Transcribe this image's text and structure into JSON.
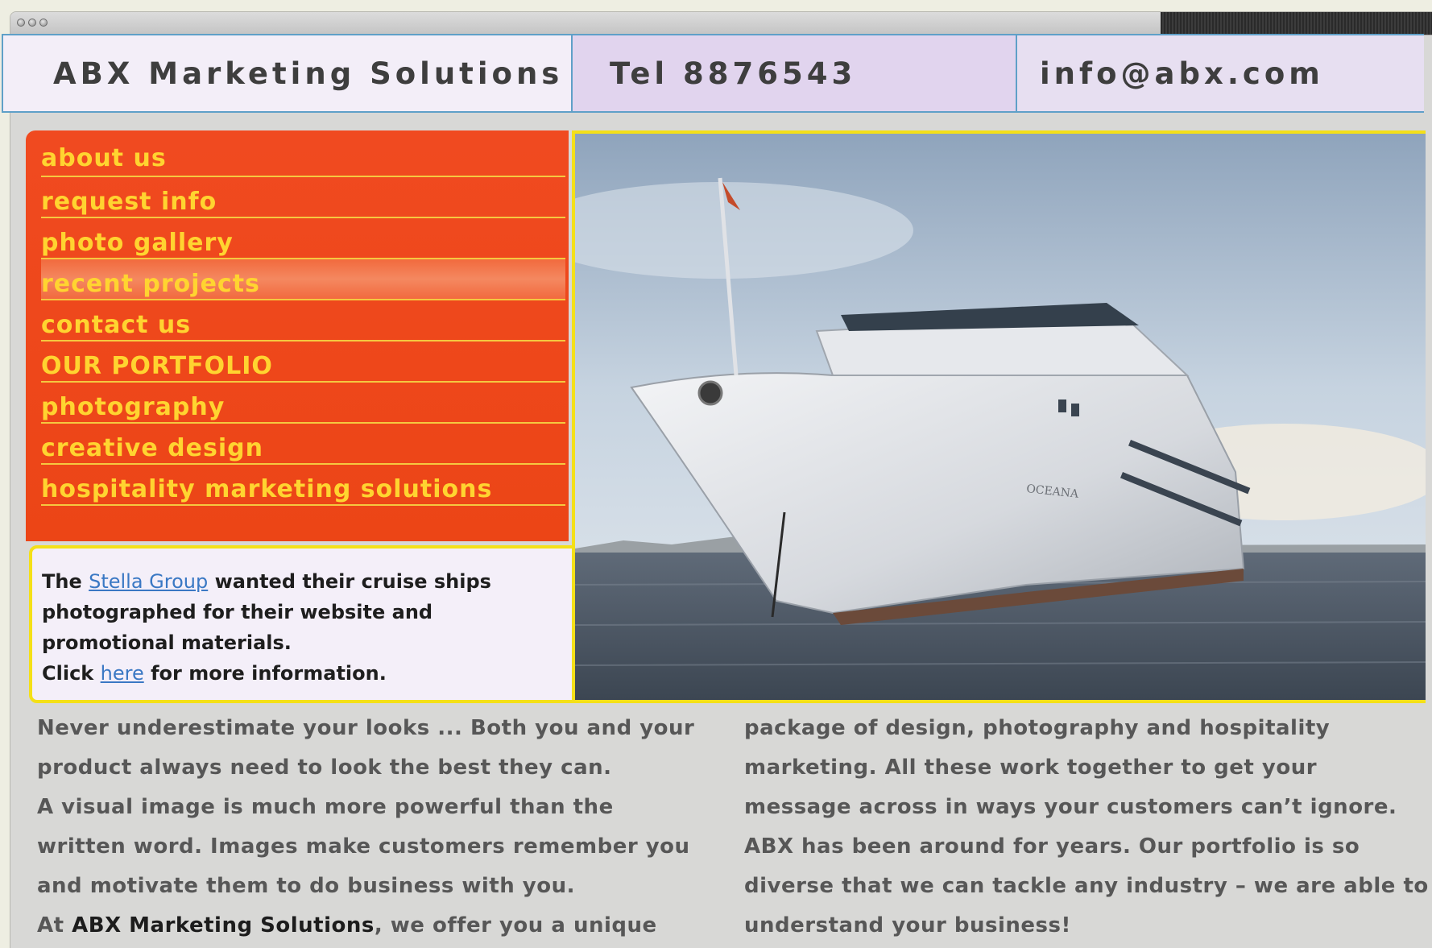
{
  "header": {
    "brand": "ABX Marketing Solutions",
    "phone": "Tel 8876543",
    "email": "info@abx.com"
  },
  "nav": {
    "items": [
      {
        "label": "about us"
      },
      {
        "label": "request info"
      },
      {
        "label": "photo gallery"
      },
      {
        "label": "recent projects"
      },
      {
        "label": "contact us"
      },
      {
        "label": "OUR PORTFOLIO"
      },
      {
        "label": "photography"
      },
      {
        "label": "creative design"
      },
      {
        "label": "hospitality marketing solutions"
      }
    ]
  },
  "project": {
    "intro_prefix": "The",
    "client_link": "Stella Group",
    "intro_suffix": "wanted their cruise ships photographed for their website and promotional materials.",
    "click_prefix": "Click",
    "click_link": "here",
    "click_suffix": "for more information."
  },
  "hero": {
    "hull_text": "OCEANA"
  },
  "body": {
    "left": {
      "p1": "Never underestimate your looks ... Both you and your product always need to look the best they can.",
      "p2": "A visual image is much more powerful than the written word. Images make customers remember you and motivate them to do business with you.",
      "p3_prefix": "At",
      "p3_company": "ABX Marketing Solutions",
      "p3_suffix": ", we offer you a unique"
    },
    "right": {
      "p1": "package of design, photography and hospitality marketing. All these work together to get your message across in ways your customers can’t ignore.",
      "p2": "ABX has been around for years. Our portfolio is so diverse that we can tackle any industry – we are able to understand your business!"
    }
  },
  "colors": {
    "nav_background": "#ee4618",
    "nav_text": "#ffd430",
    "accent_border": "#f4e018",
    "header_border": "#5fa0c8",
    "link": "#3a78c4"
  }
}
